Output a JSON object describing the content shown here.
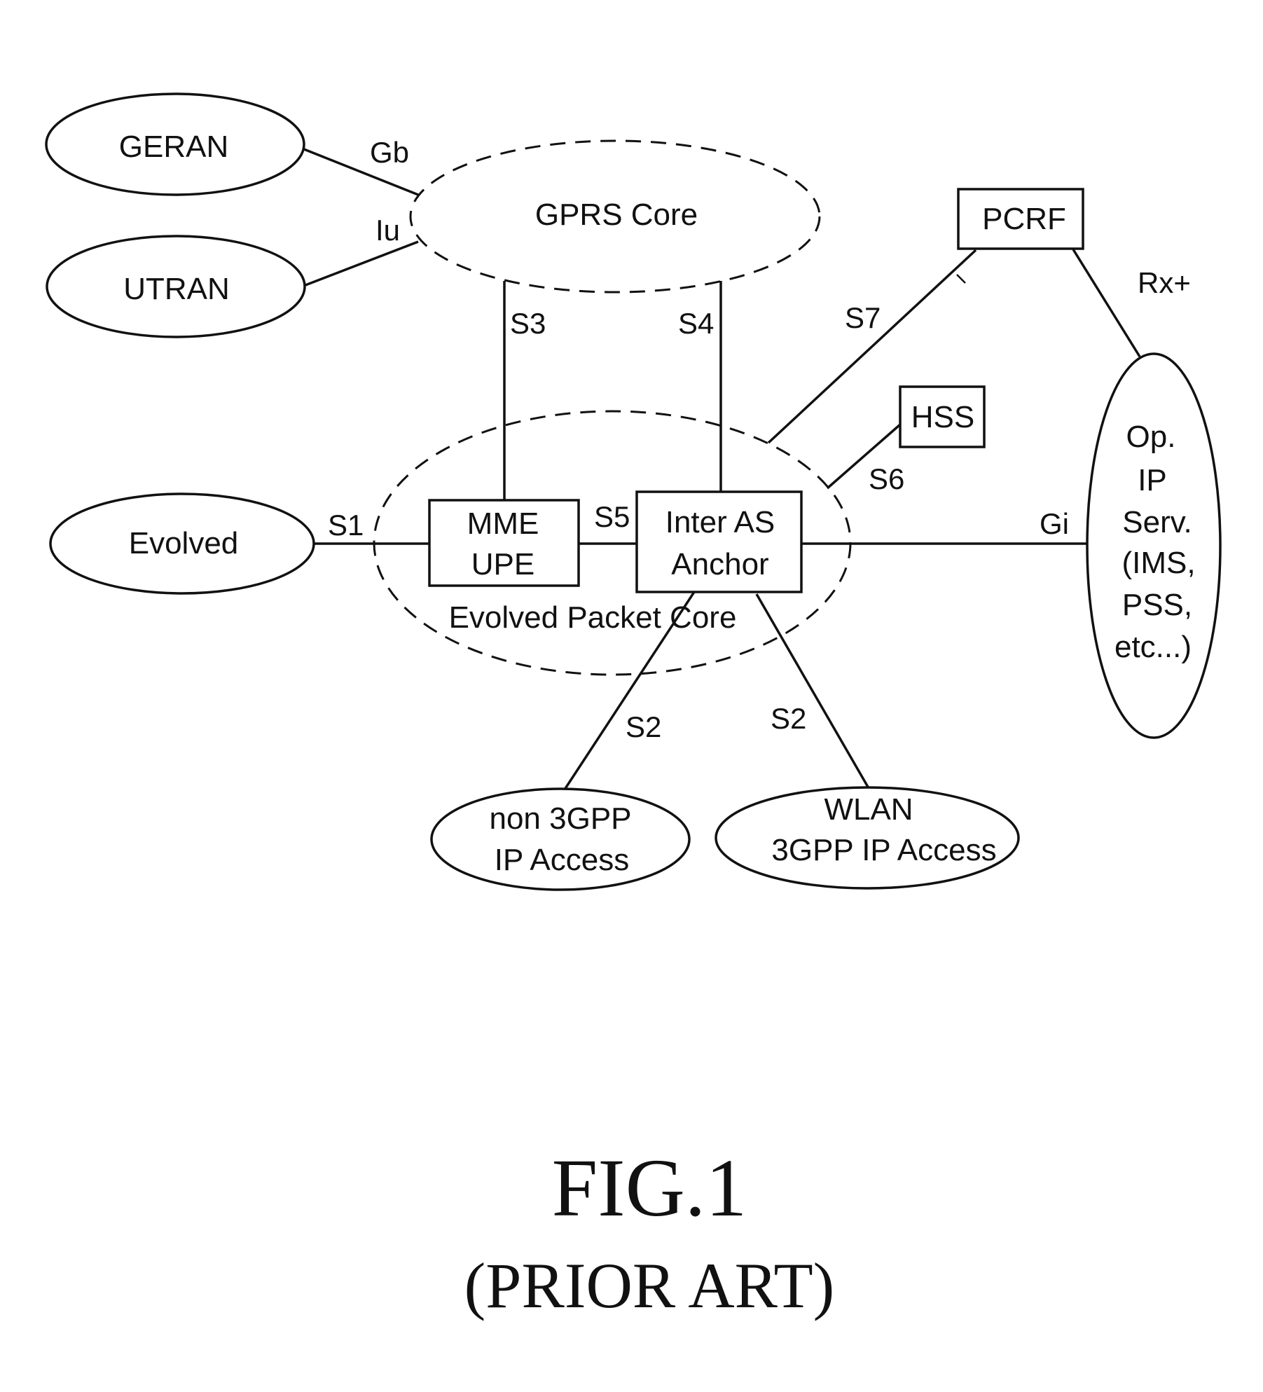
{
  "figure": {
    "caption": "FIG.1",
    "subcaption": "(PRIOR ART)"
  },
  "nodes": {
    "geran": {
      "label": [
        "GERAN"
      ],
      "shape": "ellipse"
    },
    "utran": {
      "label": [
        "UTRAN"
      ],
      "shape": "ellipse"
    },
    "gprs_core": {
      "label": [
        "GPRS Core"
      ],
      "shape": "dashed-ellipse"
    },
    "evolved": {
      "label": [
        "Evolved"
      ],
      "shape": "ellipse"
    },
    "epc": {
      "label": [
        "Evolved Packet Core"
      ],
      "shape": "dashed-ellipse"
    },
    "mme_upe": {
      "label": [
        "MME",
        "UPE"
      ],
      "shape": "box"
    },
    "inter_as_anchor": {
      "label": [
        "Inter AS",
        "Anchor"
      ],
      "shape": "box"
    },
    "pcrf": {
      "label": [
        "PCRF"
      ],
      "shape": "box"
    },
    "hss": {
      "label": [
        "HSS"
      ],
      "shape": "box"
    },
    "op_ip_serv": {
      "label": [
        "Op.",
        "IP",
        "Serv.",
        "(IMS,",
        "PSS,",
        "etc...)"
      ],
      "shape": "ellipse"
    },
    "non_3gpp": {
      "label": [
        "non 3GPP",
        "IP Access"
      ],
      "shape": "ellipse"
    },
    "wlan": {
      "label": [
        "WLAN",
        "3GPP IP Access"
      ],
      "shape": "ellipse"
    }
  },
  "edges": [
    {
      "id": "gb",
      "label": "Gb",
      "from": "GERAN",
      "to": "GPRS Core"
    },
    {
      "id": "iu",
      "label": "Iu",
      "from": "UTRAN",
      "to": "GPRS Core"
    },
    {
      "id": "s3",
      "label": "S3",
      "from": "GPRS Core",
      "to": "MME/UPE"
    },
    {
      "id": "s4",
      "label": "S4",
      "from": "GPRS Core",
      "to": "Inter AS Anchor"
    },
    {
      "id": "s1",
      "label": "S1",
      "from": "Evolved",
      "to": "MME/UPE"
    },
    {
      "id": "s5",
      "label": "S5",
      "from": "MME/UPE",
      "to": "Inter AS Anchor"
    },
    {
      "id": "s7",
      "label": "S7",
      "from": "Inter AS Anchor",
      "to": "PCRF"
    },
    {
      "id": "s6",
      "label": "S6",
      "from": "Inter AS Anchor",
      "to": "HSS"
    },
    {
      "id": "gi",
      "label": "Gi",
      "from": "Inter AS Anchor",
      "to": "Op. IP Serv."
    },
    {
      "id": "rx",
      "label": "Rx+",
      "from": "PCRF",
      "to": "Op. IP Serv."
    },
    {
      "id": "s2a",
      "label": "S2",
      "from": "Inter AS Anchor",
      "to": "non 3GPP IP Access"
    },
    {
      "id": "s2b",
      "label": "S2",
      "from": "Inter AS Anchor",
      "to": "WLAN 3GPP IP Access"
    }
  ]
}
